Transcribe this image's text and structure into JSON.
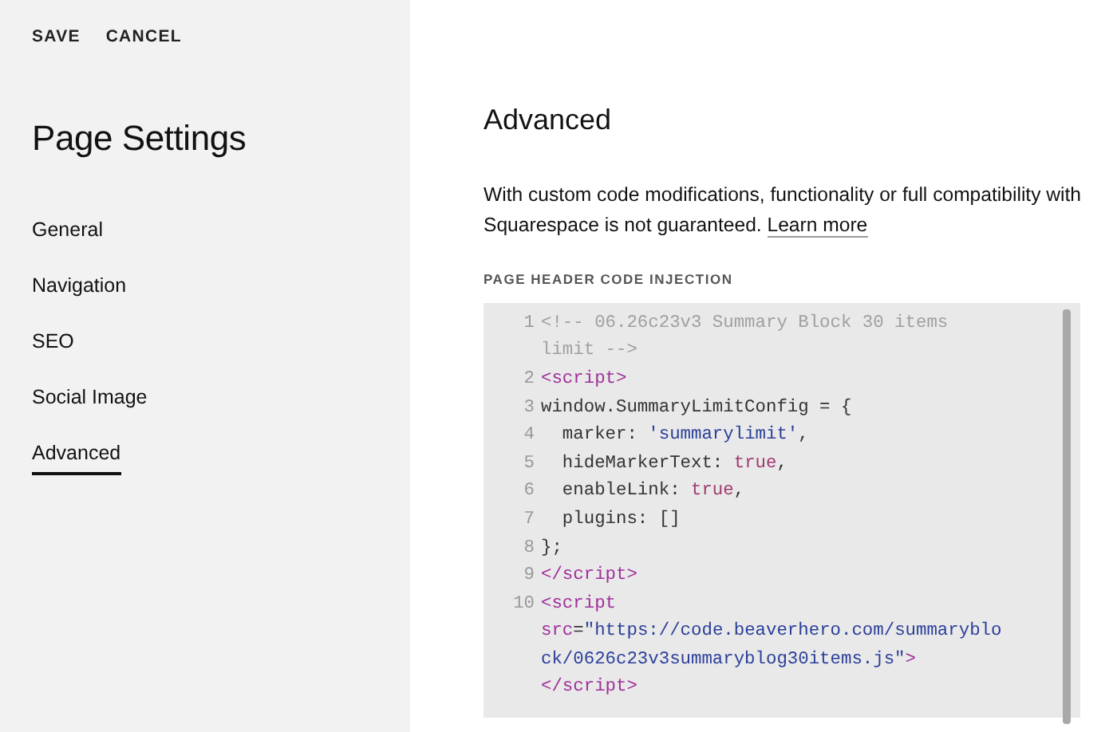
{
  "actions": [
    "SAVE",
    "CANCEL"
  ],
  "sidebar": {
    "title": "Page Settings",
    "groups": [
      {
        "items": [
          {
            "label": "General",
            "selected": false
          },
          {
            "label": "Navigation",
            "selected": false
          }
        ]
      },
      {
        "items": [
          {
            "label": "SEO",
            "selected": false
          },
          {
            "label": "Social Image",
            "selected": false
          },
          {
            "label": "Advanced",
            "selected": true
          }
        ]
      }
    ]
  },
  "main": {
    "title": "Advanced",
    "description": "With custom code modifications, functionality or full compatibility with Squarespace is not guaranteed.",
    "link": "Learn more",
    "code_label": "PAGE HEADER CODE INJECTION",
    "code_lines": [
      {
        "number": "1",
        "rows": [
          {
            "tokens": [
              {
                "kind": "comment",
                "text": "<!-- 06.26c23v3 Summary Block 30 items"
              }
            ]
          },
          {
            "tokens": [
              {
                "kind": "comment",
                "text": "limit -->"
              }
            ]
          }
        ]
      },
      {
        "number": "2",
        "rows": [
          {
            "tokens": [
              {
                "kind": "tag",
                "text": "<script>"
              }
            ]
          }
        ]
      },
      {
        "number": "3",
        "rows": [
          {
            "tokens": [
              {
                "kind": "plain",
                "text": "window.SummaryLimitConfig = {"
              }
            ]
          }
        ]
      },
      {
        "number": "4",
        "rows": [
          {
            "tokens": [
              {
                "kind": "plain",
                "text": "  marker: "
              },
              {
                "kind": "string",
                "text": "'summarylimit'"
              },
              {
                "kind": "plain",
                "text": ","
              }
            ]
          }
        ]
      },
      {
        "number": "5",
        "rows": [
          {
            "tokens": [
              {
                "kind": "plain",
                "text": "  hideMarkerText: "
              },
              {
                "kind": "atom",
                "text": "true"
              },
              {
                "kind": "plain",
                "text": ","
              }
            ]
          }
        ]
      },
      {
        "number": "6",
        "rows": [
          {
            "tokens": [
              {
                "kind": "plain",
                "text": "  enableLink: "
              },
              {
                "kind": "atom",
                "text": "true"
              },
              {
                "kind": "plain",
                "text": ","
              }
            ]
          }
        ]
      },
      {
        "number": "7",
        "rows": [
          {
            "tokens": [
              {
                "kind": "plain",
                "text": "  plugins: []"
              }
            ]
          }
        ]
      },
      {
        "number": "8",
        "rows": [
          {
            "tokens": [
              {
                "kind": "plain",
                "text": "};"
              }
            ]
          }
        ]
      },
      {
        "number": "9",
        "rows": [
          {
            "tokens": [
              {
                "kind": "tag",
                "text": "</script>"
              }
            ]
          }
        ]
      },
      {
        "number": "10",
        "rows": [
          {
            "tokens": [
              {
                "kind": "tag",
                "text": "<script"
              }
            ]
          },
          {
            "tokens": [
              {
                "kind": "attr",
                "text": "src"
              },
              {
                "kind": "plain",
                "text": "="
              },
              {
                "kind": "string",
                "text": "\"https://code.beaverhero.com/summaryblo"
              }
            ]
          },
          {
            "tokens": [
              {
                "kind": "string",
                "text": "ck/0626c23v3summaryblog30items.js\""
              },
              {
                "kind": "tag",
                "text": ">"
              }
            ]
          },
          {
            "tokens": [
              {
                "kind": "tag",
                "text": "</script>"
              }
            ]
          }
        ]
      }
    ]
  }
}
